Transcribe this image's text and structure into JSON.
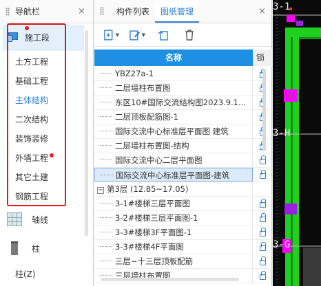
{
  "nav": {
    "title": "导航栏",
    "close": "×",
    "section": "施工段",
    "categories": [
      "土方工程",
      "基础工程",
      "主体结构",
      "二次结构",
      "装饰装修",
      "外墙工程",
      "其它土建",
      "钢筋工程"
    ],
    "active_category": "主体结构",
    "axis_label": "轴线",
    "column_label": "柱",
    "sub_item": "柱(Z)"
  },
  "mid": {
    "tabs": [
      "构件列表",
      "图纸管理"
    ],
    "active_tab": "图纸管理",
    "close": "×",
    "col_name": "名称",
    "col_lock": "锁",
    "rows": [
      {
        "name": "YBZ27a-1",
        "type": "item"
      },
      {
        "name": "二层墙柱布置图",
        "type": "item"
      },
      {
        "name": "东区10#国际交流结构图2023.9.1...",
        "type": "item"
      },
      {
        "name": "二层顶板配筋图-1",
        "type": "item"
      },
      {
        "name": "国际交流中心标准层平面图 建筑",
        "type": "item"
      },
      {
        "name": "二层墙柱布置图-结构",
        "type": "item"
      },
      {
        "name": "国际交流中心二层平面图",
        "type": "item"
      },
      {
        "name": "国际交流中心标准层平面图-建筑",
        "type": "selected"
      },
      {
        "name": "第3层 (12.85~17.05)",
        "type": "group"
      },
      {
        "name": "3-1#楼梯三层平面图",
        "type": "item"
      },
      {
        "name": "3-2#楼梯三层平面图-1",
        "type": "item"
      },
      {
        "name": "3-3#楼梯3F平面图-1",
        "type": "item"
      },
      {
        "name": "3-3#楼梯4F平面图",
        "type": "item"
      },
      {
        "name": "三层~十三层顶板配筋",
        "type": "item"
      },
      {
        "name": "三层墙柱布置图",
        "type": "item"
      }
    ]
  },
  "cad": {
    "labels": [
      "3-1",
      "3-H",
      "3-G"
    ],
    "colors": {
      "wall": "#1fd01f",
      "column": "#9b1fe0",
      "magenta": "#ff00ff",
      "bg": "#0a0a0a"
    }
  },
  "colors": {
    "accent": "#2f7fd1",
    "header_blue": "#1f8fe3",
    "highlight_box": "#e01818",
    "badge": "#e51c23"
  }
}
